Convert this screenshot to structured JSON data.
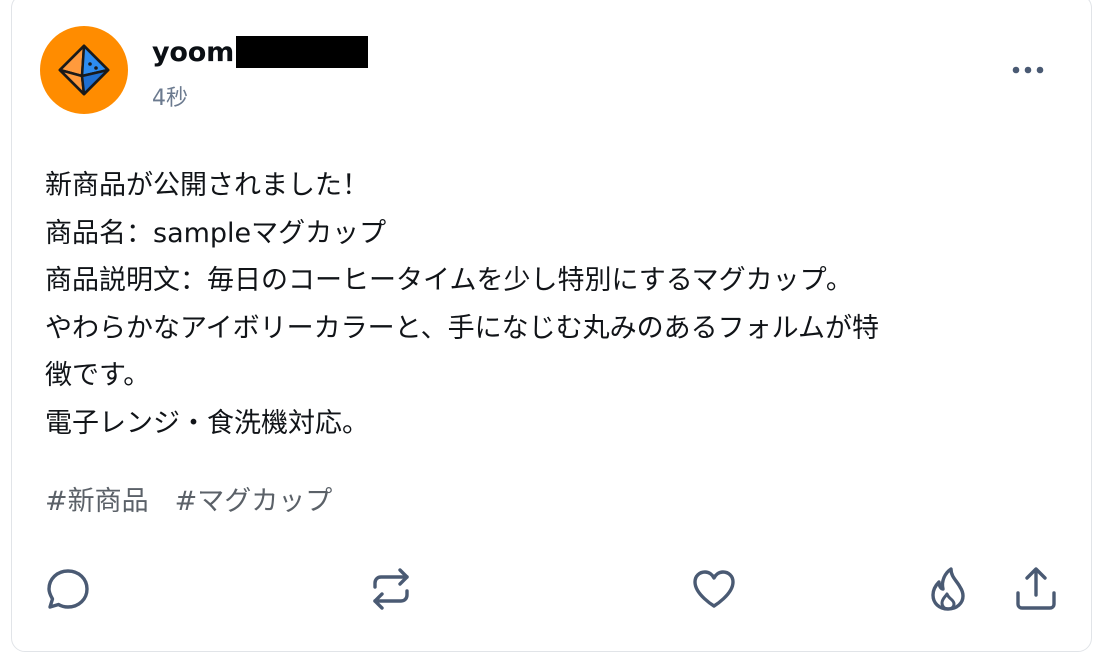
{
  "post": {
    "author": {
      "username": "yoom"
    },
    "timestamp": "4秒",
    "body_lines": [
      "新商品が公開されました！",
      "商品名：sampleマグカップ",
      "商品説明文：毎日のコーヒータイムを少し特別にするマグカップ。",
      "やわらかなアイボリーカラーと、手になじむ丸みのあるフォルムが特",
      "徴です。",
      "電子レンジ・食洗機対応。"
    ],
    "hashtags": [
      "#新商品",
      "#マグカップ"
    ]
  },
  "actions": [
    "reply",
    "repost",
    "like",
    "boost",
    "share"
  ],
  "colors": {
    "avatar_bg": "#ff8c00",
    "icon_stroke": "#4a5a73",
    "hashtag": "#5b6168"
  }
}
